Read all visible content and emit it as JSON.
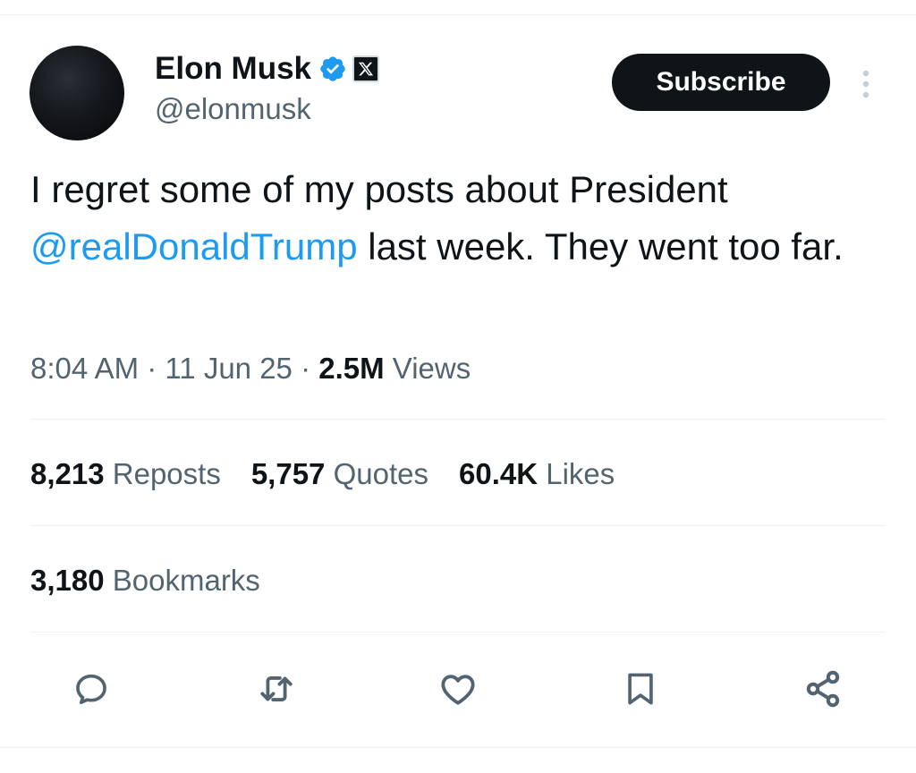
{
  "author": {
    "display_name": "Elon Musk",
    "handle": "@elonmusk",
    "verified_icon": "verified-badge-icon",
    "affiliate_icon": "x-logo-icon"
  },
  "header": {
    "subscribe_label": "Subscribe",
    "more_icon": "more-vertical-icon"
  },
  "tweet": {
    "text_before": "I regret some of my posts about President ",
    "mention": "@realDonaldTrump",
    "text_after": " last week. They went too far."
  },
  "meta": {
    "time": "8:04 AM",
    "separator_1": " · ",
    "date": "11 Jun 25",
    "separator_2": " · ",
    "views_count": "2.5M",
    "views_label": " Views"
  },
  "stats": {
    "reposts_count": "8,213",
    "reposts_label": " Reposts",
    "quotes_count": "5,757",
    "quotes_label": " Quotes",
    "likes_count": "60.4K",
    "likes_label": " Likes",
    "bookmarks_count": "3,180",
    "bookmarks_label": " Bookmarks"
  },
  "actions": [
    {
      "icon": "reply-icon"
    },
    {
      "icon": "repost-icon"
    },
    {
      "icon": "like-icon"
    },
    {
      "icon": "bookmark-icon"
    },
    {
      "icon": "share-icon"
    }
  ],
  "colors": {
    "text": "#0f1419",
    "secondary": "#536471",
    "accent": "#1d9bf0",
    "divider": "#eff3f4"
  }
}
